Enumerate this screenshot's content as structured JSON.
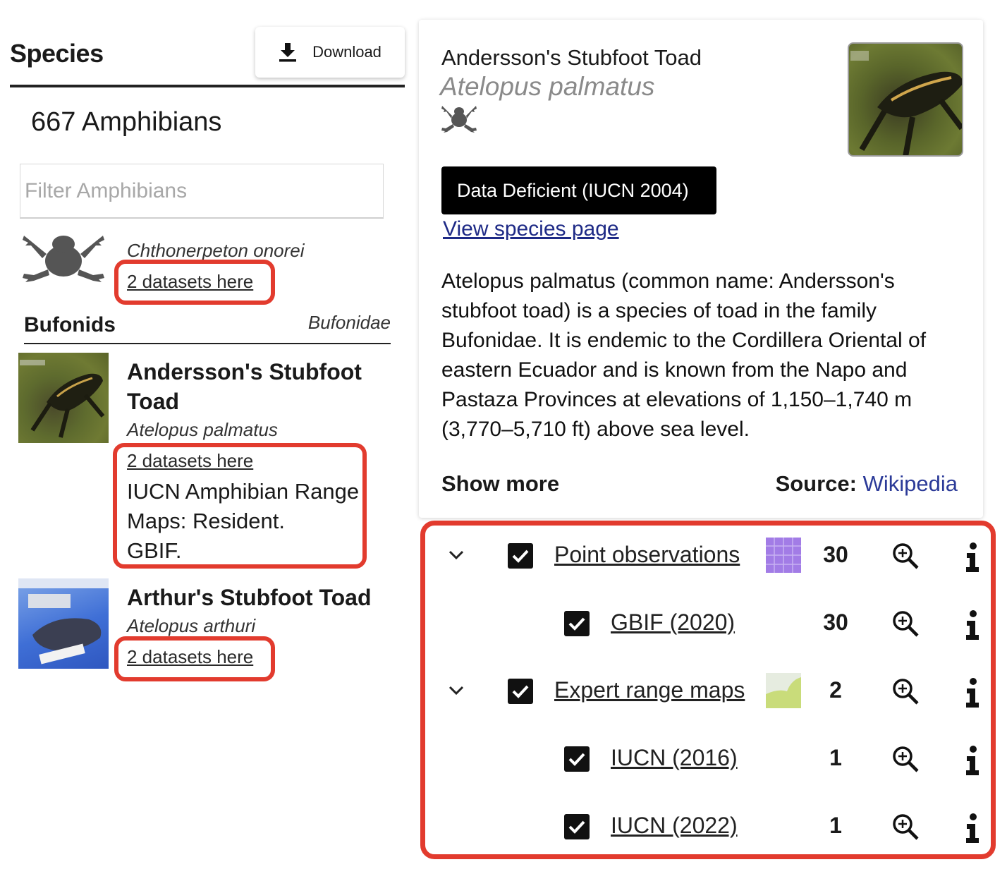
{
  "left": {
    "title": "Species",
    "download_label": "Download",
    "count_label": "667 Amphibians",
    "filter_placeholder": "Filter Amphibians",
    "ungrouped": {
      "latin": "Chthonerpeton onorei",
      "datasets_link": "2 datasets here"
    },
    "family": {
      "name": "Bufonids",
      "latin": "Bufonidae"
    },
    "species": [
      {
        "common_line1": "Andersson's Stubfoot",
        "common_line2": "Toad",
        "latin": "Atelopus palmatus",
        "datasets_link": "2 datasets here",
        "detail_line1": "IUCN Amphibian Range",
        "detail_line2": "Maps: Resident.",
        "detail_line3": "GBIF."
      },
      {
        "common": "Arthur's Stubfoot Toad",
        "latin": "Atelopus arthuri",
        "datasets_link": "2 datasets here"
      }
    ]
  },
  "card": {
    "common": "Andersson's Stubfoot Toad",
    "latin": "Atelopus palmatus",
    "status": "Data Deficient (IUCN 2004)",
    "view_link": "View species page",
    "description": "Atelopus palmatus (common name: Andersson's stubfoot toad) is a species of toad in the family Bufonidae. It is endemic to the Cordillera Oriental of eastern Ecuador and is known from the Napo and Pastaza Provinces at elevations of 1,150–1,740 m (3,770–5,710 ft) above sea level.",
    "show_more": "Show more",
    "source_label": "Source:",
    "source_link": "Wikipedia"
  },
  "datasets": [
    {
      "label": "Point observations",
      "count": "30"
    },
    {
      "label": "GBIF (2020)",
      "count": "30"
    },
    {
      "label": "Expert range maps",
      "count": "2"
    },
    {
      "label": "IUCN (2016)",
      "count": "1"
    },
    {
      "label": "IUCN (2022)",
      "count": "1"
    }
  ],
  "colors": {
    "highlight": "#e23b2e",
    "status_bg": "#000000",
    "link_blue": "#1e2a86",
    "point_swatch": "#a27ce6",
    "range_swatch": "#c9dc7a"
  }
}
